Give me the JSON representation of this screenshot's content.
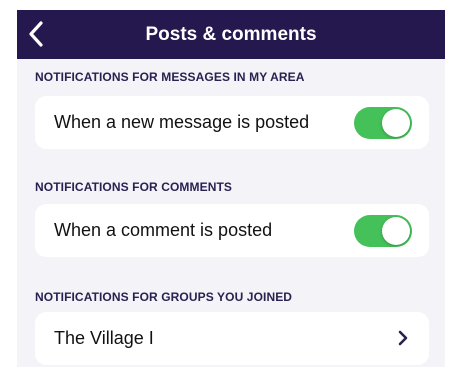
{
  "header": {
    "title": "Posts & comments",
    "back_icon": "chevron-left-icon"
  },
  "sections": [
    {
      "title": "NOTIFICATIONS FOR MESSAGES IN MY AREA",
      "row": {
        "label": "When a new message is posted",
        "toggle_on": true
      }
    },
    {
      "title": "NOTIFICATIONS FOR COMMENTS",
      "row": {
        "label": "When a comment is posted",
        "toggle_on": true
      }
    },
    {
      "title": "NOTIFICATIONS FOR GROUPS YOU JOINED",
      "row": {
        "label": "The Village I",
        "icon": "chevron-right-icon"
      }
    }
  ],
  "colors": {
    "nav_background": "#25184f",
    "screen_background": "#f3f3f8",
    "toggle_on": "#45c15a",
    "section_header_text": "#2a2150"
  }
}
